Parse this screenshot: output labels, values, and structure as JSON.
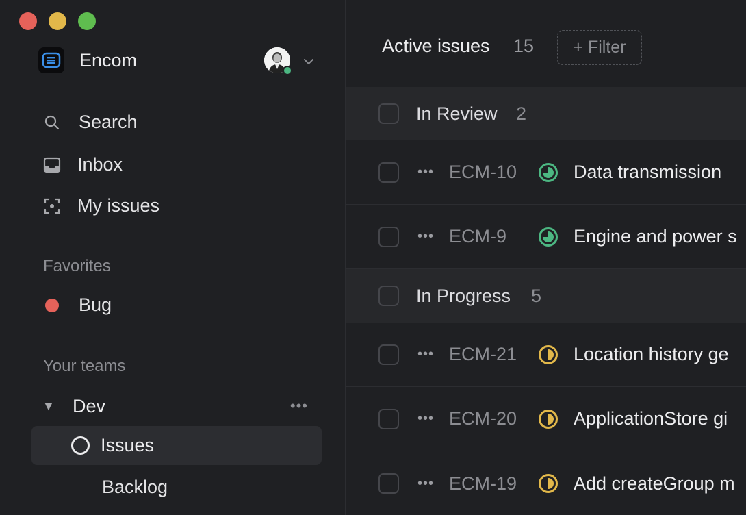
{
  "workspace": {
    "name": "Encom"
  },
  "nav": {
    "search": "Search",
    "inbox": "Inbox",
    "my_issues": "My issues"
  },
  "favorites": {
    "heading": "Favorites",
    "items": [
      {
        "label": "Bug",
        "color": "#e5625a"
      }
    ]
  },
  "teams": {
    "heading": "Your teams",
    "team": {
      "name": "Dev",
      "children": [
        {
          "label": "Issues",
          "selected": true
        },
        {
          "label": "Backlog",
          "selected": false
        }
      ]
    }
  },
  "main": {
    "title": "Active issues",
    "count": "15",
    "filter_label": "+ Filter",
    "groups": [
      {
        "name": "In Review",
        "count": "2",
        "status_color": "#4cb782",
        "issues": [
          {
            "key": "ECM-10",
            "title": "Data transmission"
          },
          {
            "key": "ECM-9",
            "title": "Engine and power s"
          }
        ]
      },
      {
        "name": "In Progress",
        "count": "5",
        "status_color": "#e2b84a",
        "issues": [
          {
            "key": "ECM-21",
            "title": "Location history ge"
          },
          {
            "key": "ECM-20",
            "title": "ApplicationStore gi"
          },
          {
            "key": "ECM-19",
            "title": "Add createGroup m"
          }
        ]
      }
    ]
  }
}
